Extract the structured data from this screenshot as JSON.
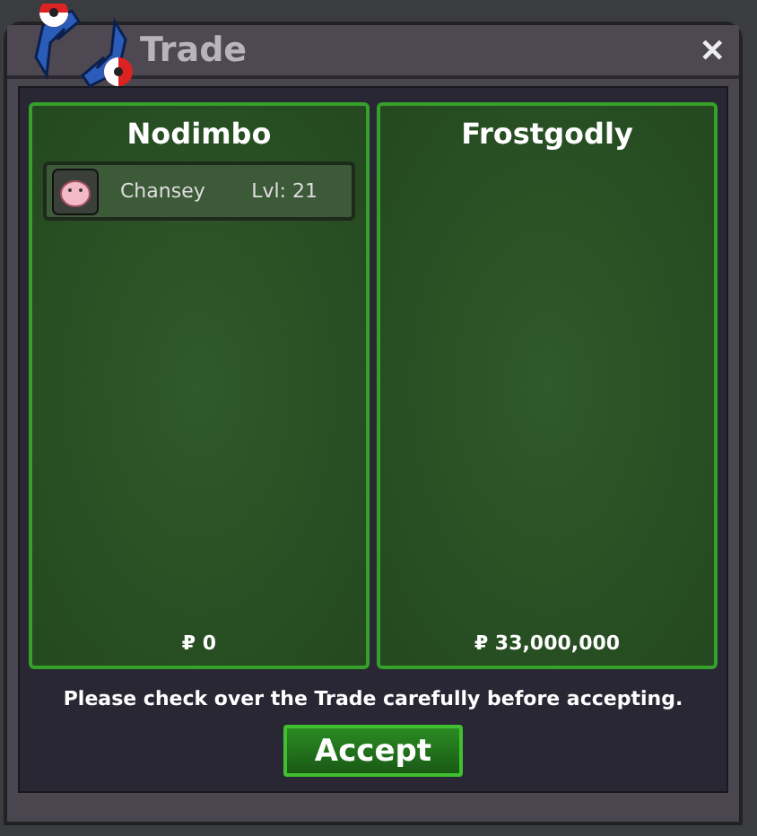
{
  "window": {
    "title": "Trade",
    "close": "✕"
  },
  "panels": [
    {
      "name": "Nodimbo",
      "items": [
        {
          "name": "Chansey",
          "level": "Lvl: 21"
        }
      ],
      "money": "₽ 0"
    },
    {
      "name": "Frostgodly",
      "money": "₽ 33,000,000"
    }
  ],
  "notice": "Please check over the Trade carefully before accepting.",
  "accept_button": "Accept"
}
